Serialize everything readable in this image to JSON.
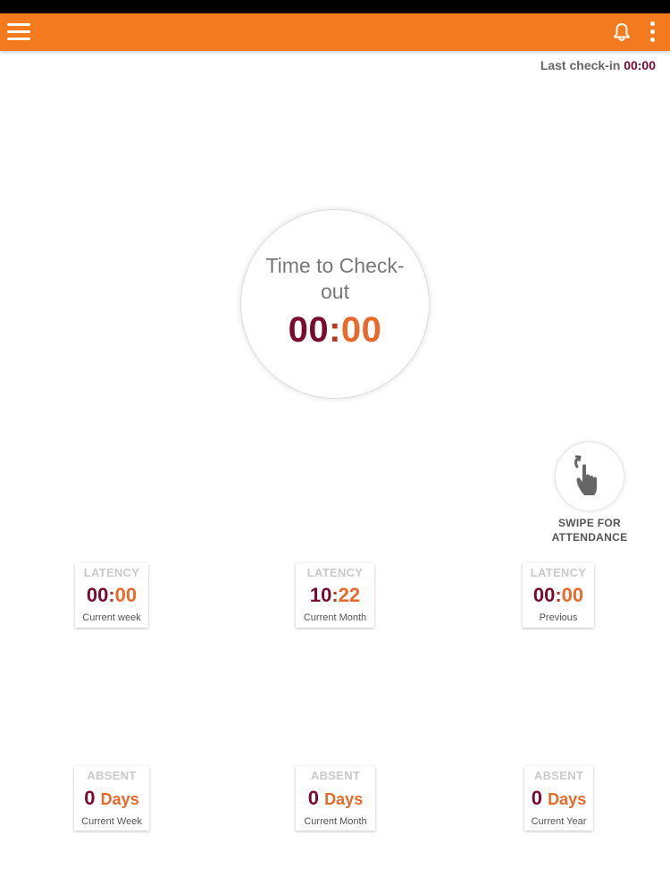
{
  "header": {
    "menu_icon": "hamburger-menu-icon",
    "bell_icon": "bell-icon",
    "more_icon": "more-vertical-icon",
    "accent_color": "#f47a20"
  },
  "last_checkin": {
    "label": "Last check-in",
    "time": "00:00"
  },
  "timer": {
    "title": "Time to Check-out",
    "hours": "00",
    "separator": ":",
    "minutes": "00"
  },
  "swipe": {
    "icon": "swipe-hand-icon",
    "label_line1": "SWIPE FOR",
    "label_line2": "ATTENDANCE"
  },
  "latency_cards": [
    {
      "title": "LATENCY",
      "hours": "00",
      "separator": ":",
      "minutes": "00",
      "subtitle": "Current week"
    },
    {
      "title": "LATENCY",
      "hours": "10",
      "separator": ":",
      "minutes": "22",
      "subtitle": "Current Month"
    },
    {
      "title": "LATENCY",
      "hours": "00",
      "separator": ":",
      "minutes": "00",
      "subtitle": "Previous"
    }
  ],
  "absent_cards": [
    {
      "title": "ABSENT",
      "count": "0",
      "unit": "Days",
      "subtitle": "Current Week"
    },
    {
      "title": "ABSENT",
      "count": "0",
      "unit": "Days",
      "subtitle": "Current Month"
    },
    {
      "title": "ABSENT",
      "count": "0",
      "unit": "Days",
      "subtitle": "Current Year"
    }
  ],
  "colors": {
    "dark_red": "#7a0b2e",
    "orange": "#e8692a"
  }
}
